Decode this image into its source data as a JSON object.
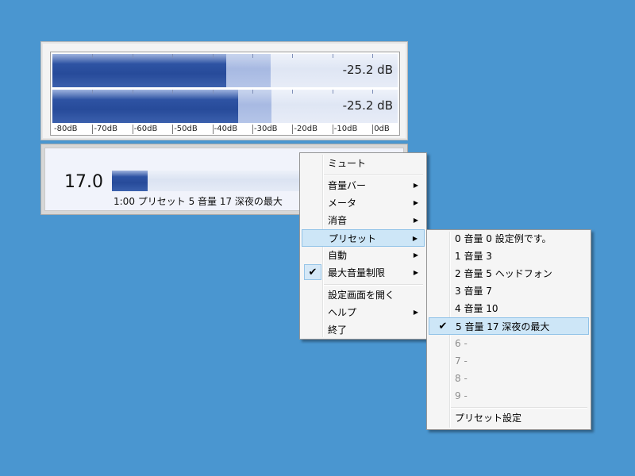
{
  "meter": {
    "channels": [
      {
        "db_text": "-25.2 dB",
        "level": 0.503,
        "peak": 0.632
      },
      {
        "db_text": "-25.2 dB",
        "level": 0.537,
        "peak": 0.634
      }
    ],
    "scale_labels": [
      "-80dB",
      "-70dB",
      "-60dB",
      "-50dB",
      "-40dB",
      "-30dB",
      "-20dB",
      "-10dB",
      "0dB"
    ]
  },
  "volume": {
    "value": "17.0",
    "level": 0.17,
    "status": "1:00 プリセット 5 音量 17 深夜の最大"
  },
  "context_menu": {
    "items": [
      {
        "label": "ミュート",
        "submenu": false
      },
      {
        "label": "音量バー",
        "submenu": true
      },
      {
        "label": "メータ",
        "submenu": true
      },
      {
        "label": "消音",
        "submenu": true
      },
      {
        "label": "プリセット",
        "submenu": true,
        "highlighted": true
      },
      {
        "label": "自動",
        "submenu": true
      },
      {
        "label": "最大音量制限",
        "submenu": true,
        "checked": true
      },
      {
        "label": "設定画面を開く",
        "submenu": false
      },
      {
        "label": "ヘルプ",
        "submenu": true
      },
      {
        "label": "終了",
        "submenu": false
      }
    ],
    "check_glyph": "✔",
    "arrow_glyph": "▶"
  },
  "preset_menu": {
    "items": [
      {
        "label": "0 音量 0 設定例です。"
      },
      {
        "label": "1 音量 3"
      },
      {
        "label": "2 音量 5 ヘッドフォン"
      },
      {
        "label": "3 音量 7"
      },
      {
        "label": "4 音量 10"
      },
      {
        "label": "5 音量 17 深夜の最大",
        "checked": true,
        "highlighted": true
      },
      {
        "label": "6 -",
        "disabled": true
      },
      {
        "label": "7 -",
        "disabled": true
      },
      {
        "label": "8 -",
        "disabled": true
      },
      {
        "label": "9 -",
        "disabled": true
      },
      {
        "label": "プリセット設定"
      }
    ]
  },
  "colors": {
    "desktop": "#4a96d0",
    "meter_level": "#2e53a3",
    "menu_highlight": "#cde6f7"
  }
}
